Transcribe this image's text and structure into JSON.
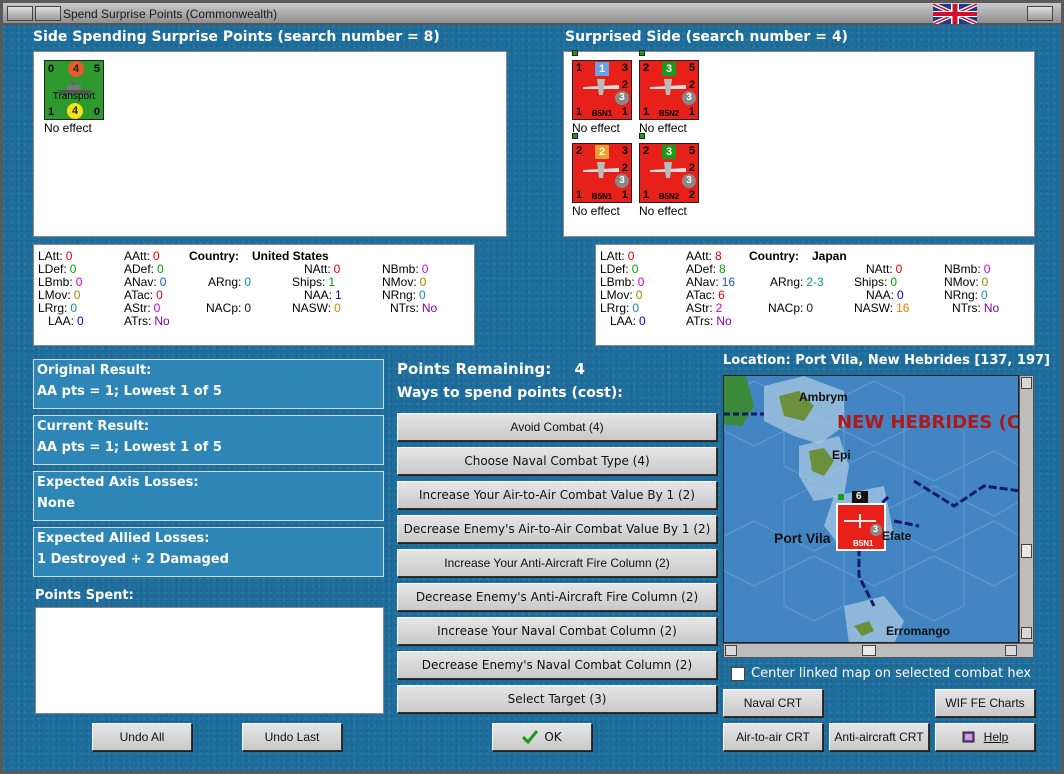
{
  "window": {
    "title": "Spend Surprise Points (Commonwealth)"
  },
  "spending_side": {
    "title": "Side Spending Surprise Points (search number = 8)",
    "counters": [
      {
        "top_left": "0",
        "top_mid": "4",
        "top_right": "5",
        "name": "Transport",
        "bottom_left": "1",
        "bottom_mid": "4",
        "bottom_right": "0",
        "color": "#2e9a2e",
        "caption": "No effect"
      }
    ]
  },
  "surprised_side": {
    "title": "Surprised Side (search number = 4)",
    "counters": [
      {
        "top_left": "1",
        "top_mid": "1",
        "top_right": "3",
        "mid_right": "2",
        "circle": "3",
        "name": "B5N1",
        "bottom_left": "1",
        "bottom_right": "1",
        "caption": "No effect"
      },
      {
        "top_left": "2",
        "top_mid": "3",
        "top_right": "5",
        "mid_right": "2",
        "circle": "3",
        "name": "B5N2",
        "bottom_left": "1",
        "bottom_right": "1",
        "caption": "No effect"
      },
      {
        "top_left": "2",
        "top_mid": "2",
        "top_right": "3",
        "mid_right": "2",
        "circle": "3",
        "name": "B5N1",
        "bottom_left": "1",
        "bottom_right": "1",
        "caption": "No effect"
      },
      {
        "top_left": "2",
        "top_mid": "3",
        "top_right": "5",
        "mid_right": "2",
        "circle": "3",
        "name": "B5N2",
        "bottom_left": "1",
        "bottom_right": "2",
        "caption": "No effect"
      }
    ]
  },
  "left_stats": {
    "country_label": "Country:",
    "country": "United States",
    "items": [
      {
        "label": "LAtt:",
        "value": "0",
        "color": "#e00000"
      },
      {
        "label": "AAtt:",
        "value": "0",
        "color": "#e00000"
      },
      {
        "label": "NAtt:",
        "value": "0",
        "color": "#e00000"
      },
      {
        "label": "LDef:",
        "value": "0",
        "color": "#00a000"
      },
      {
        "label": "ADef:",
        "value": "0",
        "color": "#00a000"
      },
      {
        "label": "NBmb:",
        "value": "0",
        "color": "#d000d0"
      },
      {
        "label": "LBmb:",
        "value": "0",
        "color": "#d000d0"
      },
      {
        "label": "ANav:",
        "value": "0",
        "color": "#2050c0"
      },
      {
        "label": "ARng:",
        "value": "0",
        "color": "#1090a0"
      },
      {
        "label": "Ships:",
        "value": "1",
        "color": "#00a000"
      },
      {
        "label": "NMov:",
        "value": "0",
        "color": "#a08000"
      },
      {
        "label": "LMov:",
        "value": "0",
        "color": "#a08000"
      },
      {
        "label": "ATac:",
        "value": "0",
        "color": "#e00000"
      },
      {
        "label": "NAA:",
        "value": "1",
        "color": "#0000c0"
      },
      {
        "label": "NRng:",
        "value": "0",
        "color": "#1090a0"
      },
      {
        "label": "LRrg:",
        "value": "0",
        "color": "#1090a0"
      },
      {
        "label": "AStr:",
        "value": "0",
        "color": "#d000d0"
      },
      {
        "label": "NACp:",
        "value": "0",
        "color": "#1a1a1a"
      },
      {
        "label": "NASW:",
        "value": "0",
        "color": "#e08000"
      },
      {
        "label": "NTrs:",
        "value": "No",
        "color": "#8000a0"
      },
      {
        "label": "LAA:",
        "value": "0",
        "color": "#0000c0"
      },
      {
        "label": "ATrs:",
        "value": "No",
        "color": "#8000a0"
      }
    ]
  },
  "right_stats": {
    "country_label": "Country:",
    "country": "Japan",
    "items": [
      {
        "label": "LAtt:",
        "value": "0",
        "color": "#e00000"
      },
      {
        "label": "AAtt:",
        "value": "8",
        "color": "#e00000"
      },
      {
        "label": "NAtt:",
        "value": "0",
        "color": "#e00000"
      },
      {
        "label": "LDef:",
        "value": "0",
        "color": "#00a000"
      },
      {
        "label": "ADef:",
        "value": "8",
        "color": "#00a000"
      },
      {
        "label": "NBmb:",
        "value": "0",
        "color": "#d000d0"
      },
      {
        "label": "LBmb:",
        "value": "0",
        "color": "#d000d0"
      },
      {
        "label": "ANav:",
        "value": "16",
        "color": "#2050c0"
      },
      {
        "label": "ARng:",
        "value": "2-3",
        "color": "#1090a0"
      },
      {
        "label": "Ships:",
        "value": "0",
        "color": "#00a000"
      },
      {
        "label": "NMov:",
        "value": "0",
        "color": "#a08000"
      },
      {
        "label": "LMov:",
        "value": "0",
        "color": "#a08000"
      },
      {
        "label": "ATac:",
        "value": "6",
        "color": "#e00000"
      },
      {
        "label": "NAA:",
        "value": "0",
        "color": "#0000c0"
      },
      {
        "label": "NRng:",
        "value": "0",
        "color": "#1090a0"
      },
      {
        "label": "LRrg:",
        "value": "0",
        "color": "#1090a0"
      },
      {
        "label": "AStr:",
        "value": "2",
        "color": "#d000d0"
      },
      {
        "label": "NACp:",
        "value": "0",
        "color": "#1a1a1a"
      },
      {
        "label": "NASW:",
        "value": "16",
        "color": "#e08000"
      },
      {
        "label": "NTrs:",
        "value": "No",
        "color": "#8000a0"
      },
      {
        "label": "LAA:",
        "value": "0",
        "color": "#0000c0"
      },
      {
        "label": "ATrs:",
        "value": "No",
        "color": "#8000a0"
      }
    ]
  },
  "results": {
    "original_label": "Original Result:",
    "original_value": "AA pts = 1; Lowest 1 of 5",
    "current_label": "Current Result:",
    "current_value": "AA pts = 1; Lowest 1 of 5",
    "axis_label": "Expected Axis Losses:",
    "axis_value": "None",
    "allied_label": "Expected Allied Losses:",
    "allied_value": "1 Destroyed + 2 Damaged",
    "points_spent_label": "Points Spent:"
  },
  "spend": {
    "points_remaining_label": "Points Remaining:",
    "points_remaining": "4",
    "ways_label": "Ways to spend points (cost):",
    "options": [
      "Avoid Combat (4)",
      "Choose Naval Combat Type (4)",
      "Increase Your Air-to-Air Combat Value By 1 (2)",
      "Decrease Enemy's Air-to-Air Combat Value By 1 (2)",
      "Increase Your Anti-Aircraft Fire Column (2)",
      "Decrease Enemy's Anti-Aircraft Fire Column (2)",
      "Increase Your Naval Combat Column (2)",
      "Decrease Enemy's Naval Combat Column (2)",
      "Select Target (3)"
    ]
  },
  "map": {
    "location": "Location: Port Vila, New Hebrides [137, 197]",
    "region_label": "NEW HEBRIDES (C",
    "places": [
      "Ambrym",
      "Epi",
      "Port Vila",
      "Efate",
      "Erromango"
    ],
    "stack_count": "6",
    "unit_name": "B5N1",
    "unit_circle": "3"
  },
  "controls": {
    "center_label": "Center linked map on selected combat hex",
    "undo_all": "Undo All",
    "undo_last": "Undo Last",
    "ok": "OK",
    "naval_crt": "Naval CRT",
    "wif_charts": "WIF FE Charts",
    "air_crt": "Air-to-air CRT",
    "aa_crt": "Anti-aircraft CRT",
    "help": "Help"
  }
}
